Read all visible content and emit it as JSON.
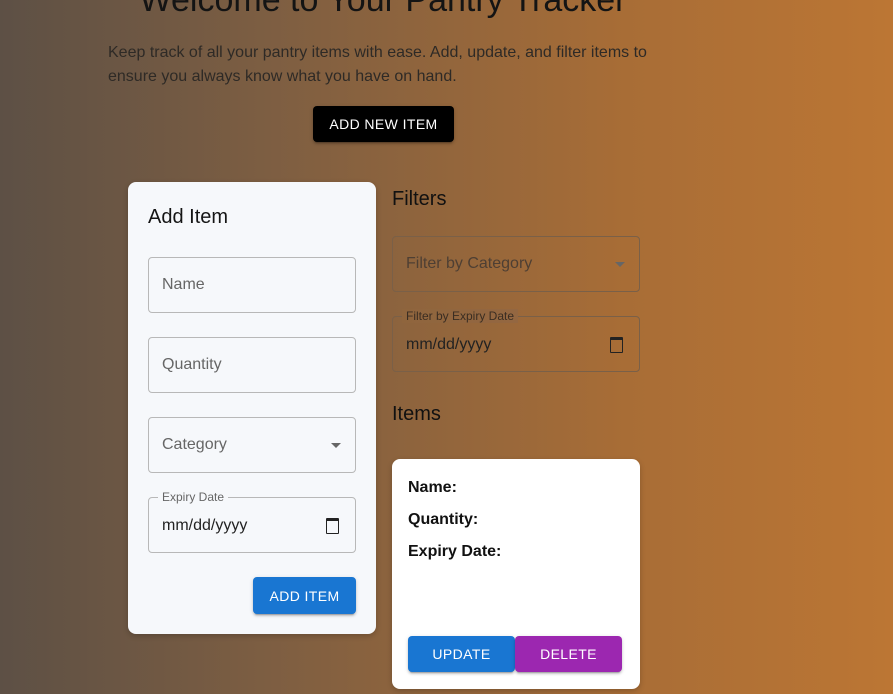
{
  "header": {
    "title": "Welcome to Your Pantry Tracker",
    "subtitle": "Keep track of all your pantry items with ease. Add, update, and filter items to ensure you always know what you have on hand.",
    "add_new_label": "Add New Item"
  },
  "add_form": {
    "title": "Add Item",
    "name_placeholder": "Name",
    "quantity_placeholder": "Quantity",
    "category_placeholder": "Category",
    "expiry_label": "Expiry Date",
    "expiry_value": "mm/dd/yyyy",
    "submit_label": "Add Item"
  },
  "filters": {
    "title": "Filters",
    "category_placeholder": "Filter by Category",
    "expiry_label": "Filter by Expiry Date",
    "expiry_value": "mm/dd/yyyy"
  },
  "items": {
    "title": "Items",
    "list": [
      {
        "name_label": "Name:",
        "quantity_label": "Quantity:",
        "expiry_label": "Expiry Date:",
        "update_label": "Update",
        "delete_label": "Delete"
      }
    ]
  },
  "colors": {
    "primary": "#1976d2",
    "secondary": "#9c27b0",
    "dark_button": "#000000",
    "card_background": "#f6f8fb"
  },
  "icons": {
    "dropdown": "chevron-down-icon",
    "date": "calendar-icon"
  }
}
